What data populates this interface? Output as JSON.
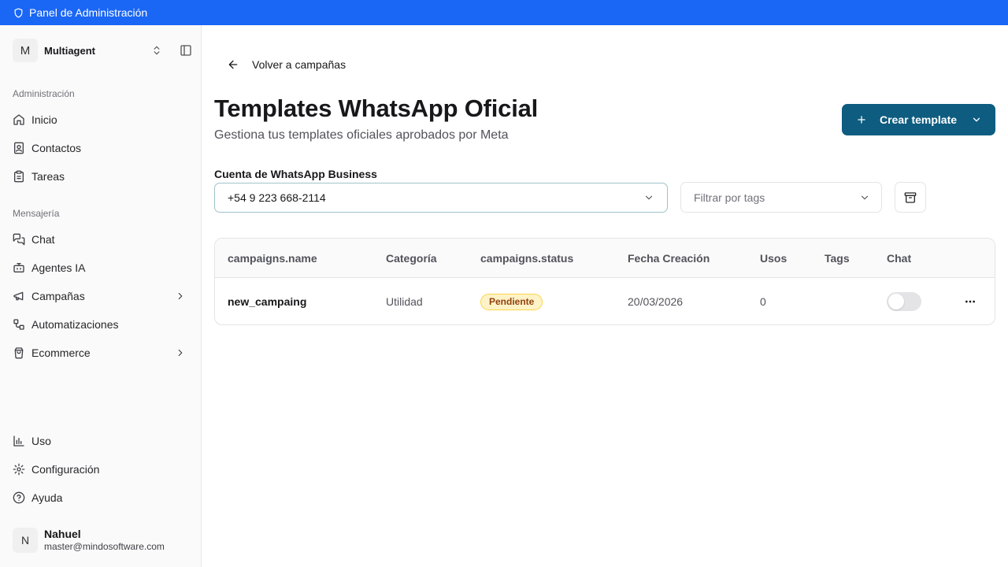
{
  "topbar": {
    "title": "Panel de Administración",
    "icon": "shield-icon"
  },
  "sidebar": {
    "workspace": {
      "avatar": "M",
      "name": "Multiagent"
    },
    "sections": [
      {
        "title": "Administración"
      },
      {
        "title": "Mensajería"
      }
    ],
    "items": [
      {
        "label": "Inicio",
        "icon": "home-icon"
      },
      {
        "label": "Contactos",
        "icon": "contacts-icon"
      },
      {
        "label": "Tareas",
        "icon": "clipboard-icon"
      },
      {
        "label": "Chat",
        "icon": "chat-icon"
      },
      {
        "label": "Agentes IA",
        "icon": "bot-icon"
      },
      {
        "label": "Campañas",
        "icon": "megaphone-icon"
      },
      {
        "label": "Automatizaciones",
        "icon": "workflow-icon"
      },
      {
        "label": "Ecommerce",
        "icon": "shopping-bag-icon"
      }
    ],
    "footer_items": [
      {
        "label": "Uso",
        "icon": "chart-icon"
      },
      {
        "label": "Configuración",
        "icon": "gear-icon"
      },
      {
        "label": "Ayuda",
        "icon": "help-icon"
      }
    ],
    "user": {
      "avatar": "N",
      "name": "Nahuel",
      "email": "master@mindosoftware.com"
    }
  },
  "main": {
    "back_label": "Volver a campañas",
    "title": "Templates WhatsApp Oficial",
    "subtitle": "Gestiona tus templates oficiales aprobados por Meta",
    "create_label": "Crear template",
    "account_label": "Cuenta de WhatsApp Business",
    "account_value": "+54 9 223 668-2114",
    "tags_placeholder": "Filtrar por tags"
  },
  "table": {
    "columns": [
      "campaigns.name",
      "Categoría",
      "campaigns.status",
      "Fecha Creación",
      "Usos",
      "Tags",
      "Chat"
    ],
    "rows": [
      {
        "name": "new_campaing",
        "category": "Utilidad",
        "status": "Pendiente",
        "created": "20/03/2026",
        "uses": "0",
        "tags": "",
        "chat_enabled": false
      }
    ]
  },
  "colors": {
    "topbar": "#1a66f5",
    "primary_button": "#0e5c80",
    "badge_bg": "#fef3c7",
    "badge_text": "#92400e"
  }
}
